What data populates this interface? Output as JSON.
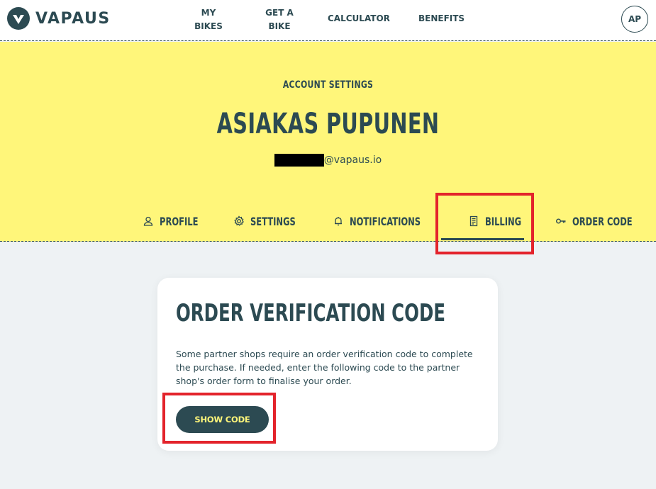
{
  "brand": {
    "name": "VAPAUS"
  },
  "nav": {
    "my_bikes": "MY BIKES",
    "get_a_bike": "GET A BIKE",
    "calculator": "CALCULATOR",
    "benefits": "BENEFITS",
    "avatar_initials": "AP"
  },
  "hero": {
    "subtitle": "ACCOUNT SETTINGS",
    "name": "ASIAKAS PUPUNEN",
    "email_domain": "@vapaus.io"
  },
  "tabs": [
    {
      "label": "PROFILE",
      "icon": "user-icon"
    },
    {
      "label": "SETTINGS",
      "icon": "gear-icon"
    },
    {
      "label": "NOTIFICATIONS",
      "icon": "bell-icon"
    },
    {
      "label": "BILLING",
      "icon": "receipt-icon"
    },
    {
      "label": "ORDER CODE",
      "icon": "key-icon",
      "active": true
    }
  ],
  "card": {
    "title": "ORDER VERIFICATION CODE",
    "body": "Some partner shops require an order verification code to complete the purchase. If needed, enter the following code to the partner shop's order form to finalise your order.",
    "button": "SHOW CODE"
  },
  "colors": {
    "primary": "#2c4a52",
    "hero_bg": "#fff67a",
    "page_bg": "#eef2f4",
    "annotation": "#e3232b"
  }
}
